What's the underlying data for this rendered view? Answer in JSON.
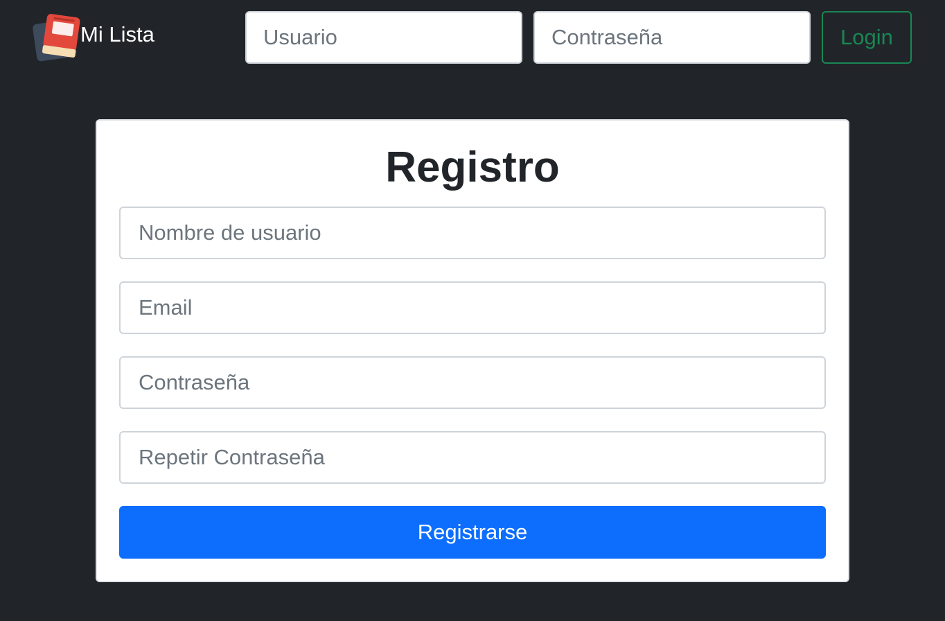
{
  "navbar": {
    "brand": "Mi Lista",
    "username_placeholder": "Usuario",
    "password_placeholder": "Contraseña",
    "login_label": "Login"
  },
  "register": {
    "title": "Registro",
    "username_placeholder": "Nombre de usuario",
    "email_placeholder": "Email",
    "password_placeholder": "Contraseña",
    "repeat_password_placeholder": "Repetir Contraseña",
    "submit_label": "Registrarse"
  },
  "icons": {
    "brand_logo": "book-icon"
  },
  "colors": {
    "background": "#212529",
    "login_outline": "#198754",
    "primary": "#0d6efd"
  }
}
